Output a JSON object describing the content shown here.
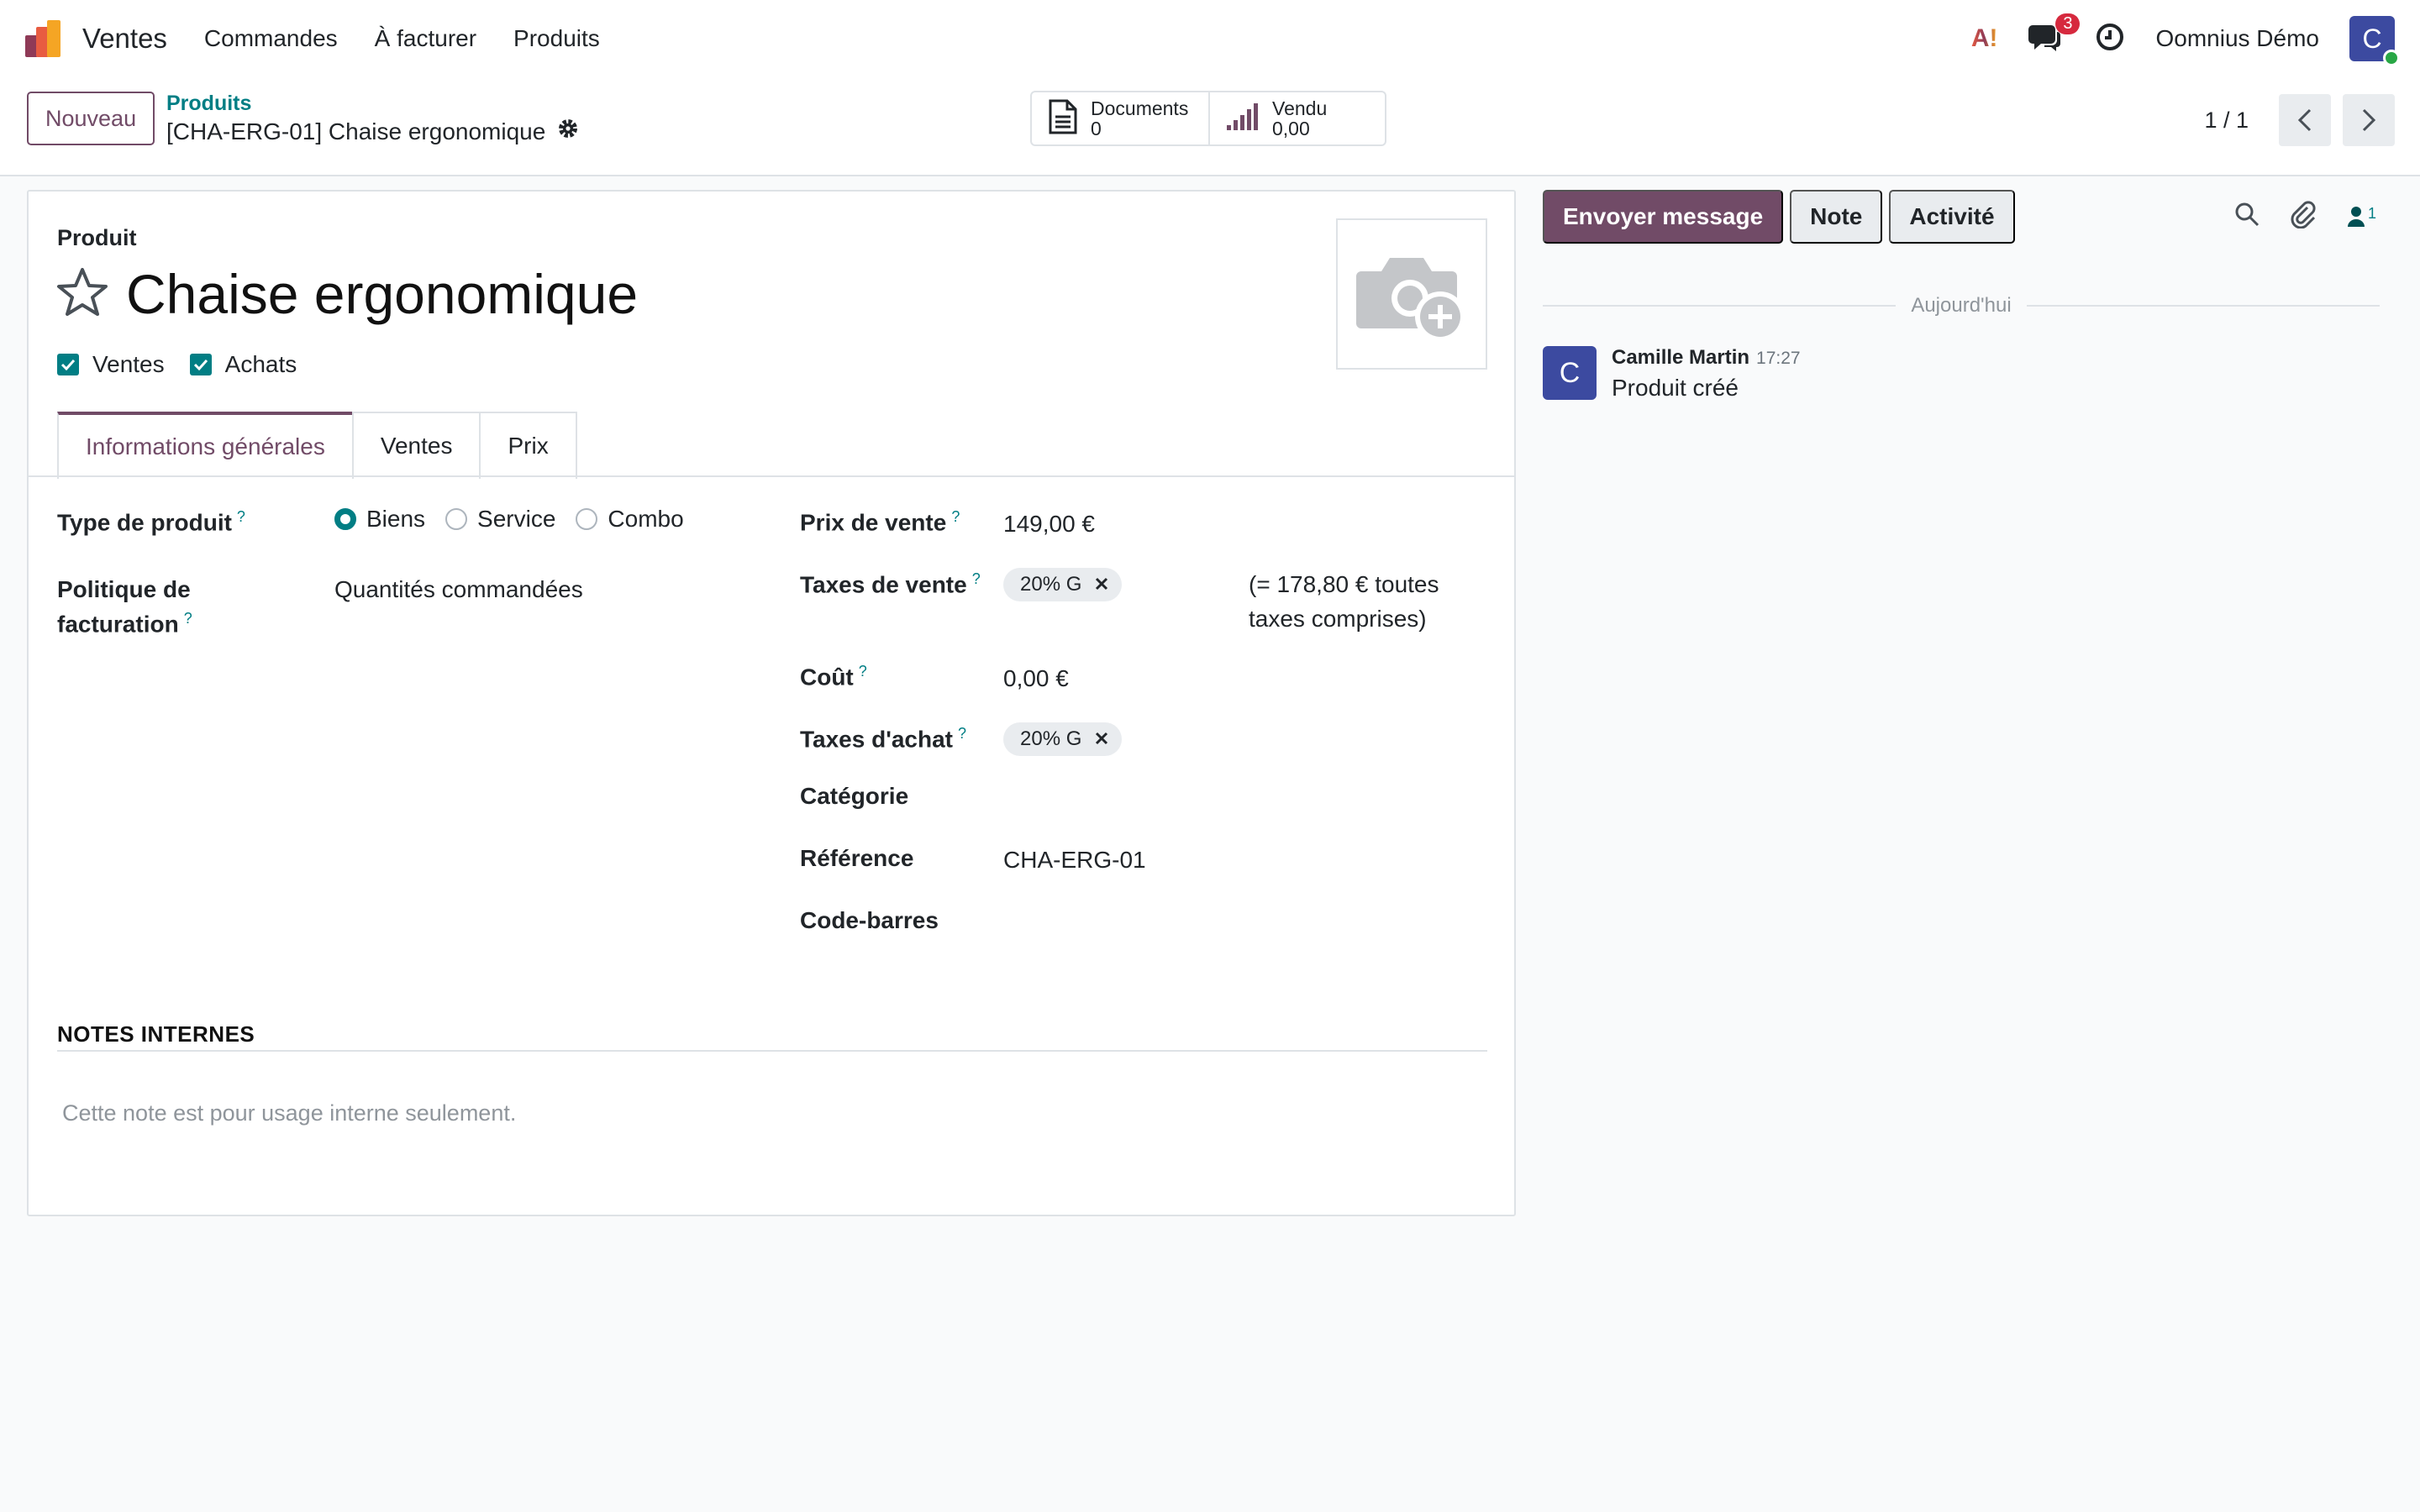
{
  "navbar": {
    "app_name": "Ventes",
    "menu": [
      "Commandes",
      "À facturer",
      "Produits"
    ],
    "notification_count": "3",
    "user_name": "Oomnius Démo",
    "user_initial": "C"
  },
  "control": {
    "new_label": "Nouveau",
    "breadcrumb_parent": "Produits",
    "breadcrumb_current": "[CHA-ERG-01] Chaise ergonomique",
    "smart_buttons": [
      {
        "label": "Documents",
        "value": "0",
        "icon": "document-icon"
      },
      {
        "label": "Vendu",
        "value": "0,00",
        "icon": "bar-chart-icon"
      }
    ],
    "pager": "1 / 1"
  },
  "form": {
    "product_label": "Produit",
    "product_name": "Chaise ergonomique",
    "checkboxes": [
      {
        "label": "Ventes",
        "checked": true
      },
      {
        "label": "Achats",
        "checked": true
      }
    ],
    "tabs": [
      "Informations générales",
      "Ventes",
      "Prix"
    ],
    "active_tab": "Informations générales",
    "fields": {
      "product_type": {
        "label": "Type de produit",
        "options": [
          "Biens",
          "Service",
          "Combo"
        ],
        "selected": "Biens"
      },
      "invoice_policy": {
        "label_1": "Politique de",
        "label_2": "facturation",
        "value": "Quantités commandées"
      },
      "sale_price": {
        "label": "Prix de vente",
        "value": "149,00 €"
      },
      "sale_taxes": {
        "label": "Taxes de vente",
        "tag": "20% G",
        "tax_incl_1": "(= 178,80 € toutes",
        "tax_incl_2": "taxes comprises)"
      },
      "cost": {
        "label": "Coût",
        "value": "0,00 €"
      },
      "purchase_taxes": {
        "label": "Taxes d'achat",
        "tag": "20% G"
      },
      "category": {
        "label": "Catégorie",
        "value": ""
      },
      "reference": {
        "label": "Référence",
        "value": "CHA-ERG-01"
      },
      "barcode": {
        "label": "Code-barres",
        "value": ""
      }
    },
    "notes": {
      "title": "NOTES INTERNES",
      "placeholder": "Cette note est pour usage interne seulement."
    }
  },
  "chatter": {
    "buttons": [
      "Envoyer message",
      "Note",
      "Activité"
    ],
    "follower_count": "1",
    "date_separator": "Aujourd'hui",
    "messages": [
      {
        "initial": "C",
        "author": "Camille Martin",
        "time": "17:27",
        "body": "Produit créé"
      }
    ]
  },
  "colors": {
    "brand": "#714b67",
    "accent": "#017e84",
    "badge": "#d6293e",
    "avatar": "#3c4aa0"
  }
}
